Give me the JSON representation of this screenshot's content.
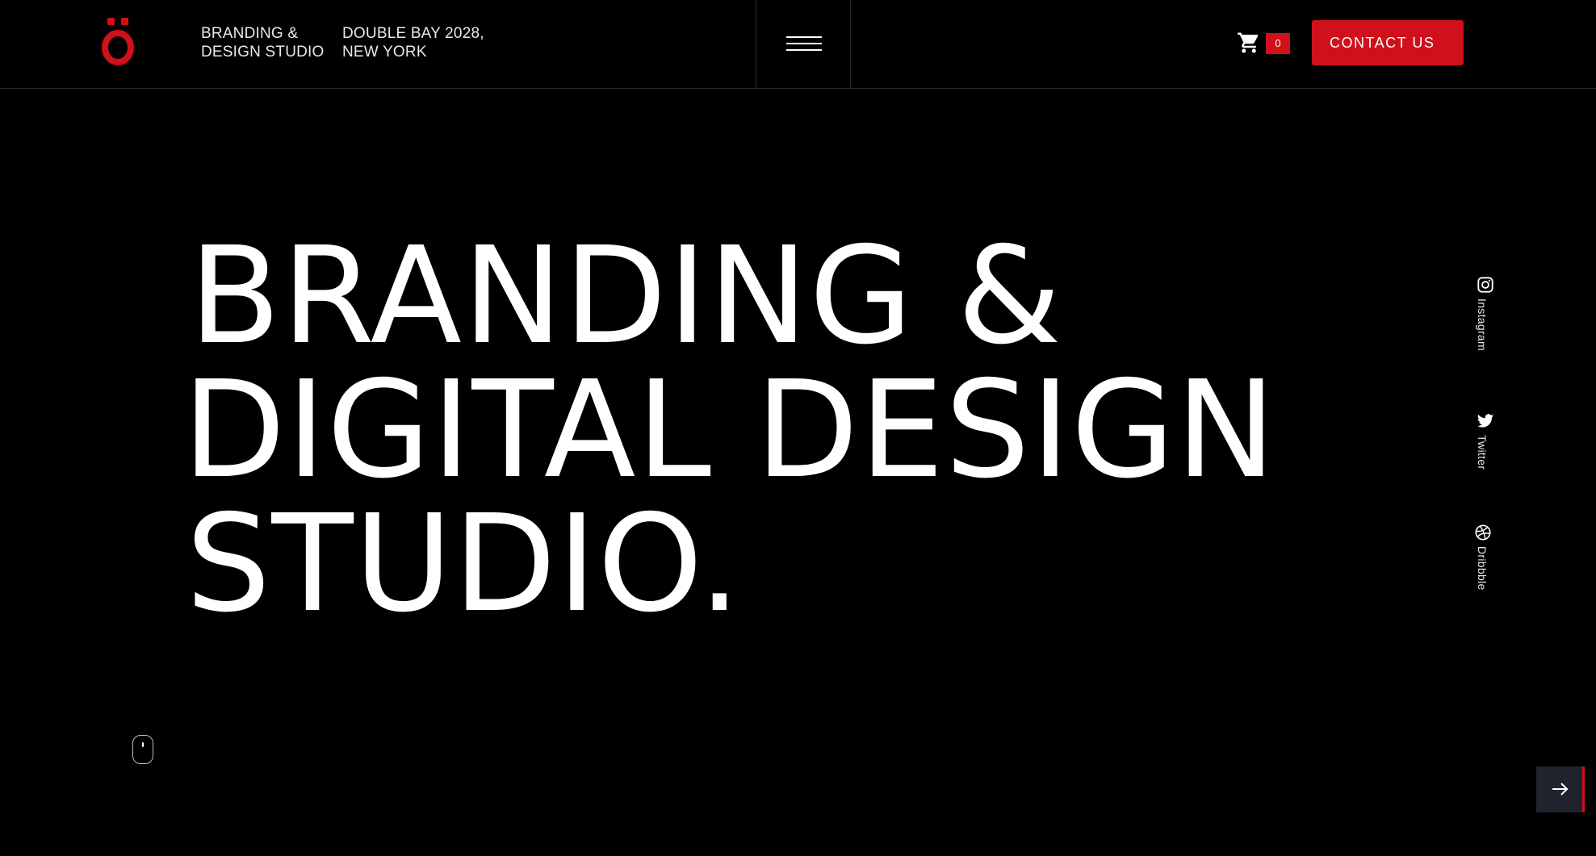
{
  "header": {
    "logo_glyph": "ö",
    "brand_color": "#d0101a",
    "tagline_line1": "BRANDING &",
    "tagline_line2": "DESIGN STUDIO",
    "address_line1": "DOUBLE BAY 2028,",
    "address_line2": "NEW YORK",
    "menu_icon": "hamburger-menu-icon",
    "cart_icon": "shopping-cart-icon",
    "cart_count": "0",
    "contact_label": "CONTACT US"
  },
  "hero": {
    "line1": "BRANDING &",
    "line2": "DIGITAL DESIGN",
    "line3": "STUDIO."
  },
  "social": [
    {
      "label": "Instagram",
      "icon": "instagram-icon"
    },
    {
      "label": "Twitter",
      "icon": "twitter-icon"
    },
    {
      "label": "Dribbble",
      "icon": "dribbble-icon"
    }
  ],
  "scroll_indicator_icon": "mouse-scroll-icon",
  "next_icon": "arrow-right-icon"
}
